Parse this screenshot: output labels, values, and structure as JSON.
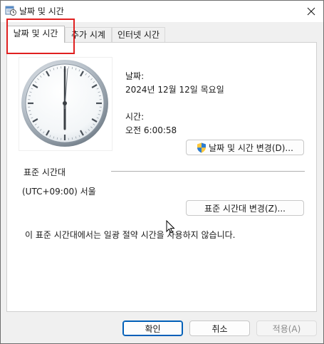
{
  "window": {
    "title": "날짜 및 시간",
    "close_glyph": "✕"
  },
  "tabs": [
    {
      "label": "날짜 및 시간",
      "active": true
    },
    {
      "label": "추가 시계",
      "active": false
    },
    {
      "label": "인터넷 시간",
      "active": false
    }
  ],
  "datetime": {
    "date_label": "날짜:",
    "date_value": "2024년 12월 12일 목요일",
    "time_label": "시간:",
    "time_value": "오전 6:00:58",
    "change_button": "날짜 및 시간 변경(D)..."
  },
  "timezone": {
    "section_label": "표준 시간대",
    "value": "(UTC+09:00) 서울",
    "change_button": "표준 시간대 변경(Z)...",
    "dst_note": "이 표준 시간대에서는 일광 절약 시간을 사용하지 않습니다."
  },
  "footer": {
    "ok": "확인",
    "cancel": "취소",
    "apply": "적용(A)"
  },
  "colors": {
    "highlight": "#e02020",
    "primary_border": "#005fb8"
  },
  "icons": [
    "calendar-clock-icon",
    "close-icon",
    "shield-icon",
    "mouse-cursor-icon"
  ]
}
